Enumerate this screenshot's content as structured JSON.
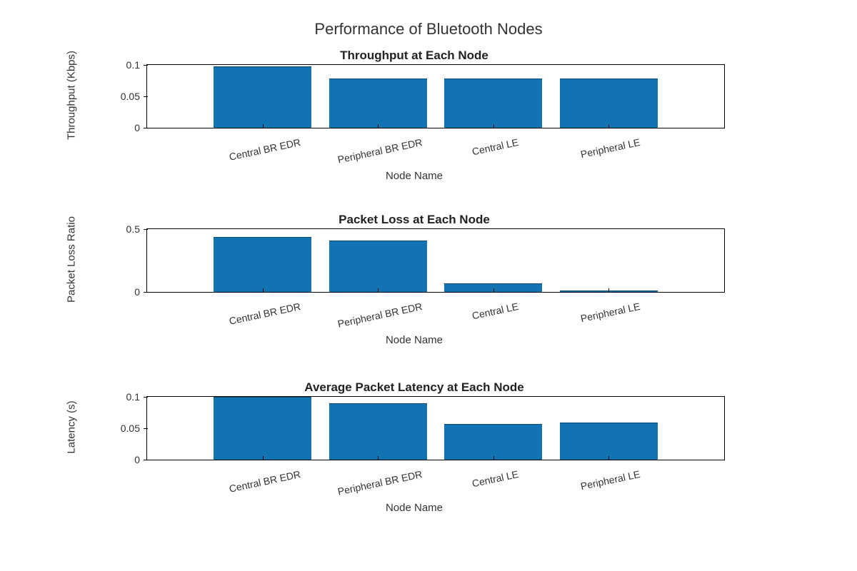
{
  "suptitle": "Performance of Bluetooth Nodes",
  "categories": [
    "Central BR EDR",
    "Peripheral BR EDR",
    "Central LE",
    "Peripheral LE"
  ],
  "chart_data": [
    {
      "type": "bar",
      "title": "Throughput at Each Node",
      "xlabel": "Node Name",
      "ylabel": "Throughput (Kbps)",
      "ylim": [
        0,
        0.1
      ],
      "yticks": [
        0,
        0.05,
        0.1
      ],
      "categories": [
        "Central BR EDR",
        "Peripheral BR EDR",
        "Central LE",
        "Peripheral LE"
      ],
      "values": [
        0.098,
        0.078,
        0.078,
        0.078
      ]
    },
    {
      "type": "bar",
      "title": "Packet Loss at Each Node",
      "xlabel": "Node Name",
      "ylabel": "Packet Loss Ratio",
      "ylim": [
        0,
        0.5
      ],
      "yticks": [
        0,
        0.5
      ],
      "categories": [
        "Central BR EDR",
        "Peripheral BR EDR",
        "Central LE",
        "Peripheral LE"
      ],
      "values": [
        0.44,
        0.41,
        0.07,
        0.01
      ]
    },
    {
      "type": "bar",
      "title": "Average Packet Latency at Each Node",
      "xlabel": "Node Name",
      "ylabel": "Latency (s)",
      "ylim": [
        0,
        0.1
      ],
      "yticks": [
        0,
        0.05,
        0.1
      ],
      "categories": [
        "Central BR EDR",
        "Peripheral BR EDR",
        "Central LE",
        "Peripheral LE"
      ],
      "values": [
        0.102,
        0.09,
        0.057,
        0.059
      ]
    }
  ],
  "layout": {
    "subplot_tops": [
      90,
      320,
      555
    ],
    "subplot_height": 90,
    "xlabel_offset": 58,
    "bar_width_pct": 17,
    "slot_width_pct": 20,
    "slot_start_pct": 10
  }
}
